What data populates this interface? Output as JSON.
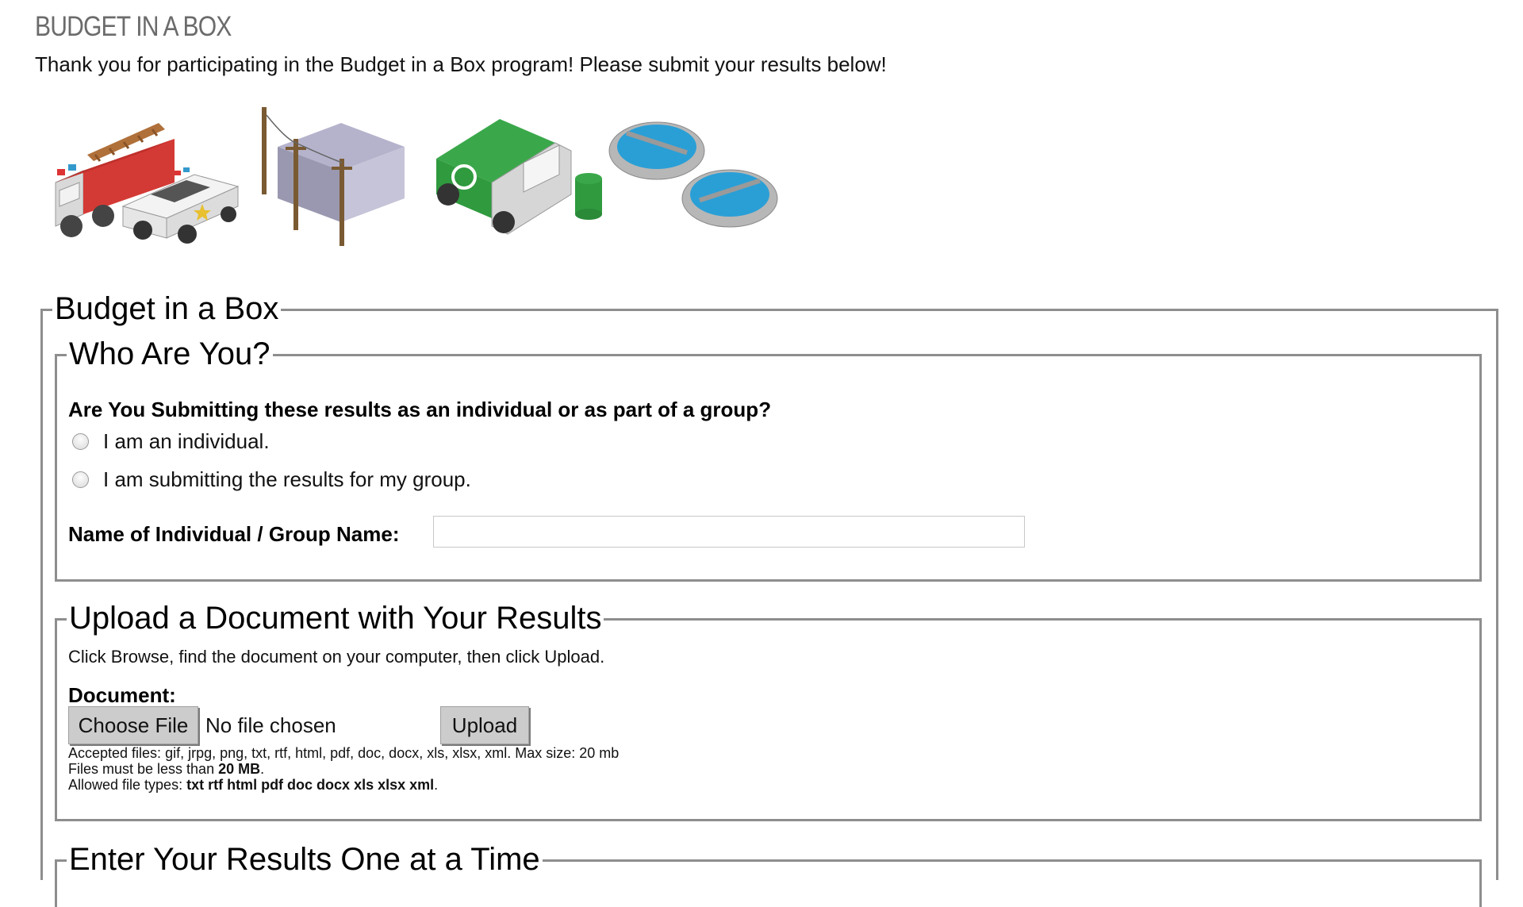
{
  "site": {
    "title": "BUDGET IN A BOX",
    "intro": "Thank you for participating in the Budget in a Box program! Please submit your results below!"
  },
  "banner": {
    "icons": [
      "fire-truck-icon",
      "police-car-icon",
      "power-lines-icon",
      "garbage-truck-icon",
      "recycling-bin-icon",
      "water-treatment-icon"
    ]
  },
  "form": {
    "legend": "Budget in a Box",
    "who": {
      "legend": "Who Are You?",
      "question": "Are You Submitting these results as an individual or as part of a group?",
      "options": [
        {
          "label": "I am an individual.",
          "selected": false
        },
        {
          "label": "I am submitting the results for my group.",
          "selected": false
        }
      ],
      "name_label": "Name of Individual / Group Name:",
      "name_value": ""
    },
    "upload": {
      "legend": "Upload a Document with Your Results",
      "instructions": "Click Browse, find the document on your computer, then click Upload.",
      "document_label": "Document:",
      "choose_label": "Choose File",
      "no_file": "No file chosen",
      "upload_label": "Upload",
      "accepted": "Accepted files: gif, jrpg, png, txt, rtf, html, pdf, doc, docx, xls, xlsx, xml. Max size: 20 mb",
      "size_prefix": "Files must be less than ",
      "size_value": "20 MB",
      "size_suffix": ".",
      "types_prefix": "Allowed file types: ",
      "types_value": "txt rtf html pdf doc docx xls xlsx xml",
      "types_suffix": "."
    },
    "enter": {
      "legend": "Enter Your Results One at a Time"
    }
  },
  "colors": {
    "border": "#8e8e8e",
    "button_bg": "#cccccc",
    "title_gray": "#6b6b6b"
  }
}
